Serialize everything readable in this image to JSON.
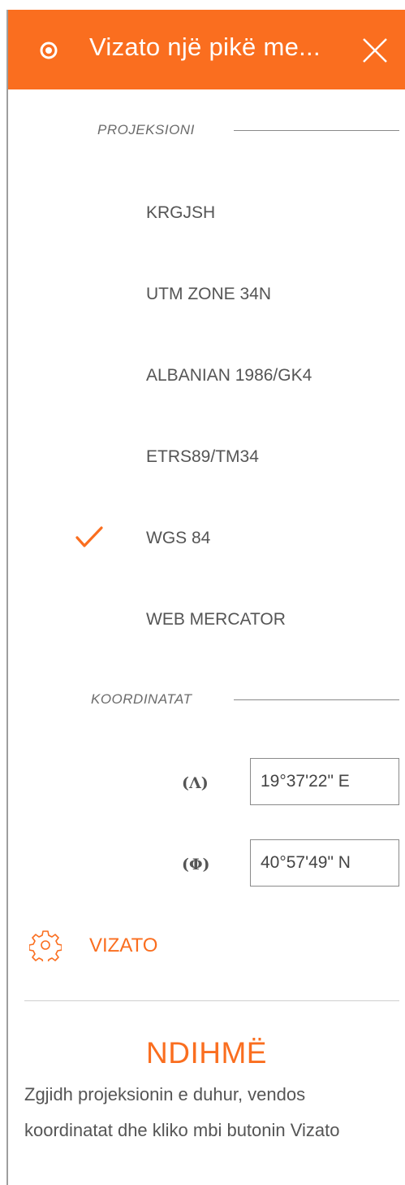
{
  "header": {
    "title": "Vizato një pikë me...",
    "icon": "target-icon",
    "close_icon": "close-icon",
    "color": "#fa6e1f"
  },
  "projection_section": {
    "label": "PROJEKSIONI",
    "items": [
      {
        "label": "KRGJSH",
        "selected": false
      },
      {
        "label": "UTM ZONE 34N",
        "selected": false
      },
      {
        "label": "ALBANIAN 1986/GK4",
        "selected": false
      },
      {
        "label": "ETRS89/TM34",
        "selected": false
      },
      {
        "label": "WGS 84",
        "selected": true
      },
      {
        "label": "WEB MERCATOR",
        "selected": false
      }
    ]
  },
  "coordinates_section": {
    "label": "KOORDINATAT",
    "longitude": {
      "symbol": "(Λ)",
      "value": "19°37'22\" E"
    },
    "latitude": {
      "symbol": "(Φ)",
      "value": "40°57'49\" N"
    }
  },
  "draw_button": {
    "label": "VIZATO",
    "icon": "gear-icon"
  },
  "help": {
    "title": "NDIHMË",
    "text": "Zgjidh projeksionin e duhur, vendos koordinatat dhe kliko mbi butonin Vizato"
  }
}
